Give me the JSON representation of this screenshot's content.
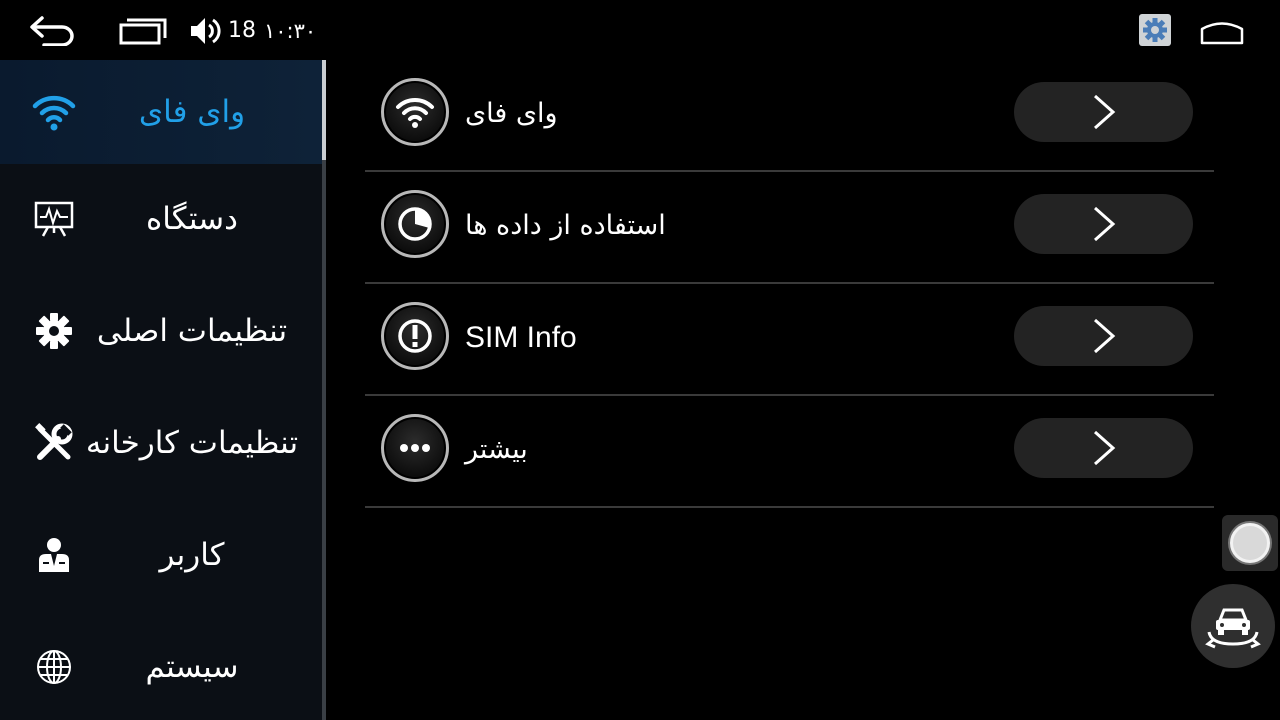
{
  "statusbar": {
    "volume_level": "18",
    "time": "۱۰:۳۰",
    "icons": [
      "back-icon",
      "recents-icon",
      "volume-icon",
      "settings-icon",
      "home-icon"
    ]
  },
  "sidebar": {
    "items": [
      {
        "label": "وای فای",
        "icon": "wifi-icon",
        "active": true
      },
      {
        "label": "دستگاه",
        "icon": "device-monitor-icon",
        "active": false
      },
      {
        "label": "تنظیمات اصلی",
        "icon": "gear-icon",
        "active": false
      },
      {
        "label": "تنظیمات کارخانه",
        "icon": "tools-icon",
        "active": false
      },
      {
        "label": "کاربر",
        "icon": "user-icon",
        "active": false
      },
      {
        "label": "سیستم",
        "icon": "globe-icon",
        "active": false
      }
    ]
  },
  "main": {
    "rows": [
      {
        "label": "وای فای",
        "icon": "wifi-icon"
      },
      {
        "label": "استفاده از داده ها",
        "icon": "data-usage-icon"
      },
      {
        "label": "SIM Info",
        "icon": "info-exclamation-icon"
      },
      {
        "label": "بیشتر",
        "icon": "more-dots-icon"
      }
    ]
  },
  "colors": {
    "accent": "#21a0e8",
    "sidebar_bg": "#0b0f15",
    "button_bg": "#232323"
  }
}
